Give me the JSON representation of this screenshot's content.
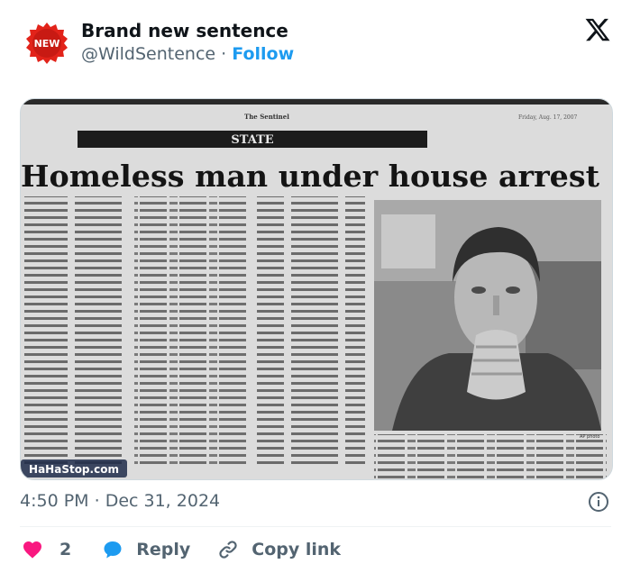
{
  "author": {
    "display_name": "Brand new sentence",
    "handle": "@WildSentence",
    "separator": "·",
    "follow_label": "Follow",
    "avatar_badge": "NEW"
  },
  "media": {
    "newspaper_name": "The Sentinel",
    "date_line": "Friday, Aug. 17, 2007",
    "section": "STATE",
    "headline": "Homeless man under house arrest",
    "watermark": "HaHaStop.com",
    "photo_credit": "AP photo"
  },
  "tweet": {
    "time": "4:50 PM",
    "separator": "·",
    "date": "Dec 31, 2024"
  },
  "actions": {
    "like_count": "2",
    "reply_label": "Reply",
    "copy_link_label": "Copy link"
  },
  "colors": {
    "like": "#f91880",
    "reply": "#1d9bf0",
    "follow": "#1d9bf0",
    "badge": "#e2231a",
    "muted": "#536471"
  }
}
